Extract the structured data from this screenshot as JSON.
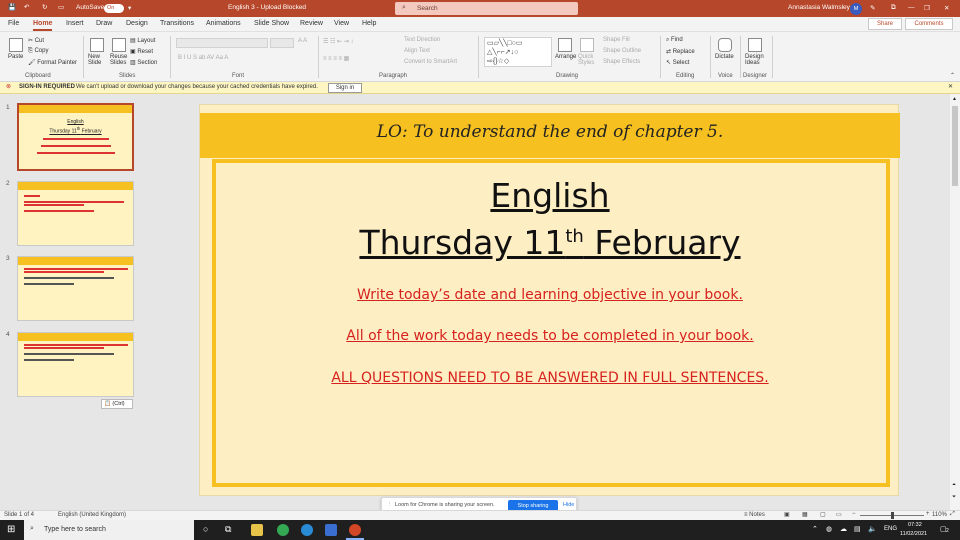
{
  "titlebar": {
    "autosave_label": "AutoSave",
    "autosave_state": "On",
    "doc_title": "English 3 - Upload Blocked",
    "search_placeholder": "Search",
    "user_name": "Annastasia Walmsley",
    "user_initials": "M",
    "accent": "#b7472a"
  },
  "tabs": [
    "File",
    "Home",
    "Insert",
    "Draw",
    "Design",
    "Transitions",
    "Animations",
    "Slide Show",
    "Review",
    "View",
    "Help"
  ],
  "active_tab": "Home",
  "share_label": "Share",
  "comments_label": "Comments",
  "ribbon": {
    "clipboard": {
      "paste": "Paste",
      "cut": "Cut",
      "copy": "Copy",
      "format_painter": "Format Painter",
      "group": "Clipboard"
    },
    "slides": {
      "new_slide": "New Slide",
      "reuse_slides": "Reuse Slides",
      "layout": "Layout",
      "reset": "Reset",
      "section": "Section",
      "group": "Slides"
    },
    "font": {
      "group": "Font"
    },
    "paragraph": {
      "text_direction": "Text Direction",
      "align_text": "Align Text",
      "smartart": "Convert to SmartArt",
      "group": "Paragraph"
    },
    "drawing": {
      "arrange": "Arrange",
      "quick_styles": "Quick Styles",
      "shape_fill": "Shape Fill",
      "shape_outline": "Shape Outline",
      "shape_effects": "Shape Effects",
      "group": "Drawing"
    },
    "editing": {
      "find": "Find",
      "replace": "Replace",
      "select": "Select",
      "group": "Editing"
    },
    "voice": {
      "dictate": "Dictate",
      "group": "Voice"
    },
    "designer": {
      "design_ideas": "Design Ideas",
      "group": "Designer"
    }
  },
  "infobar": {
    "label": "SIGN-IN REQUIRED",
    "message": "We can't upload or download your changes because your cached credentials have expired.",
    "button": "Sign in"
  },
  "thumbnails": [
    {
      "num": "1",
      "title": "LO: To understand the end of chapter 5."
    },
    {
      "num": "2",
      "title": "LO: To understand the end of chapter 5."
    },
    {
      "num": "3",
      "title": "LO: To understand the end of chapter 5."
    },
    {
      "num": "4",
      "title": "LO: To understand the end of chapter 5."
    }
  ],
  "paste_options": "(Ctrl)",
  "slide": {
    "lo": "LO: To understand the end of chapter 5.",
    "subject": "English",
    "date_prefix": "Thursday 11",
    "date_sup": "th",
    "date_suffix": " February",
    "line1": "Write today’s date and learning objective in your book.",
    "line2": "All of the work today needs to be completed in your book.",
    "line3": "ALL QUESTIONS NEED TO BE ANSWERED IN FULL SENTENCES.",
    "band_color": "#f5c020",
    "bg_color": "#fdeec3",
    "text_red": "#d6221f"
  },
  "share_pill": {
    "message": "Loom for Chrome is sharing your screen.",
    "stop": "Stop sharing",
    "hide": "Hide"
  },
  "statusbar": {
    "slide_info": "Slide 1 of 4",
    "language": "English (United Kingdom)",
    "notes": "Notes",
    "zoom": "110%"
  },
  "taskbar": {
    "search_placeholder": "Type here to search",
    "lang": "ENG",
    "time": "07:32",
    "date": "11/02/2021",
    "notif": "2"
  }
}
